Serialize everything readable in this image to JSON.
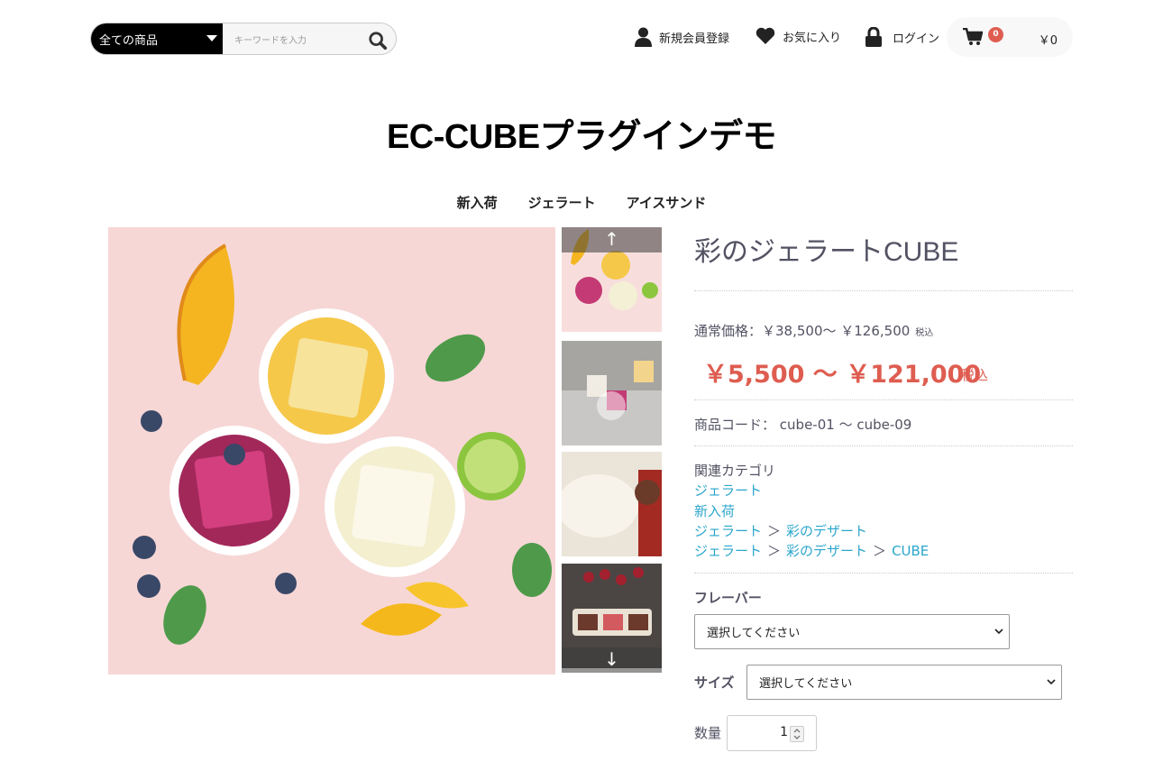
{
  "header": {
    "category_select": "全ての商品",
    "search_placeholder": "キーワードを入力",
    "register": "新規会員登録",
    "favorites": "お気に入り",
    "login": "ログイン",
    "cart_count": "0",
    "cart_total": "￥0"
  },
  "site_title": "EC-CUBEプラグインデモ",
  "gnav": [
    "新入荷",
    "ジェラート",
    "アイスサンド"
  ],
  "gallery": {
    "up_arrow": "↑",
    "down_arrow": "↓"
  },
  "product": {
    "name": "彩のジェラートCUBE",
    "normal_price_label": "通常価格：￥38,500〜 ￥126,500",
    "normal_price_tax": "税込",
    "sale_price": "￥5,500 〜 ￥121,000",
    "sale_tax": "税込",
    "code_label": "商品コード：",
    "code_value": "cube-01 〜 cube-09",
    "related_label": "関連カテゴリ",
    "categories": [
      [
        "ジェラート"
      ],
      [
        "新入荷"
      ],
      [
        "ジェラート",
        "彩のデザート"
      ],
      [
        "ジェラート",
        "彩のデザート",
        "CUBE"
      ]
    ],
    "category_sep": "＞",
    "flavor_label": "フレーバー",
    "flavor_value": "選択してください",
    "size_label": "サイズ",
    "size_value": "選択してください",
    "qty_label": "数量",
    "qty_value": "1"
  },
  "colors": {
    "accent_red": "#de5d50",
    "link_blue": "#2ba6cb",
    "text": "#525263"
  }
}
